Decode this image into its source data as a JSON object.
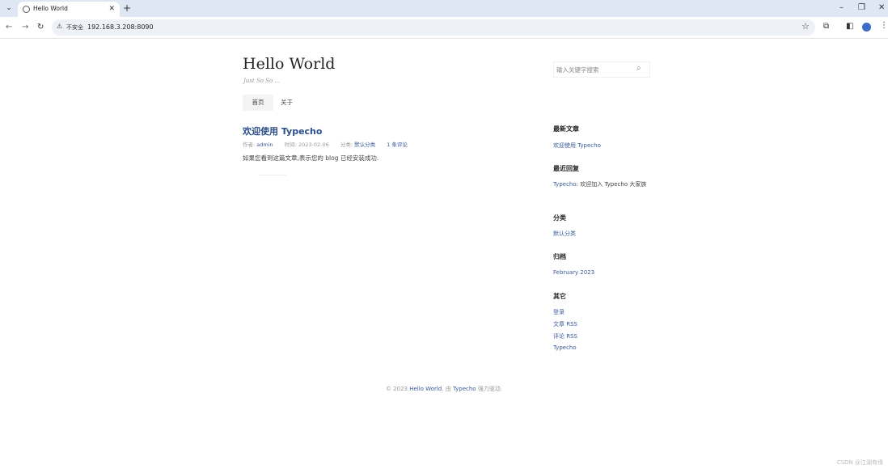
{
  "browser": {
    "tab_title": "Hello World",
    "security_label": "不安全",
    "url": "192.168.3.208:8090"
  },
  "site": {
    "title": "Hello World",
    "description": "Just So So ...",
    "search_placeholder": "输入关键字搜索"
  },
  "nav": {
    "home": "首页",
    "about": "关于"
  },
  "post": {
    "title": "欢迎使用 Typecho",
    "meta_author_label": "作者: ",
    "meta_author": "admin",
    "meta_time": "时间: 2023-02-06",
    "meta_category_label": "分类: ",
    "meta_category": "默认分类",
    "meta_comments": "1 条评论",
    "body": "如果您看到这篇文章,表示您的 blog 已经安装成功."
  },
  "sidebar": {
    "recent_posts_title": "最新文章",
    "recent_post": "欢迎使用 Typecho",
    "recent_comments_title": "最近回复",
    "recent_comment_author": "Typecho",
    "recent_comment_text": ": 欢迎加入 Typecho 大家族",
    "categories_title": "分类",
    "category": "默认分类",
    "archives_title": "归档",
    "archive": "February 2023",
    "other_title": "其它",
    "other_login": "登录",
    "other_posts_rss": "文章 RSS",
    "other_comments_rss": "评论 RSS",
    "other_typecho": "Typecho"
  },
  "footer": {
    "prefix": "© 2023 ",
    "site": "Hello World",
    "middle": ". 由 ",
    "engine": "Typecho",
    "suffix": " 强力驱动."
  },
  "watermark": "CSDN @江湖有缘"
}
